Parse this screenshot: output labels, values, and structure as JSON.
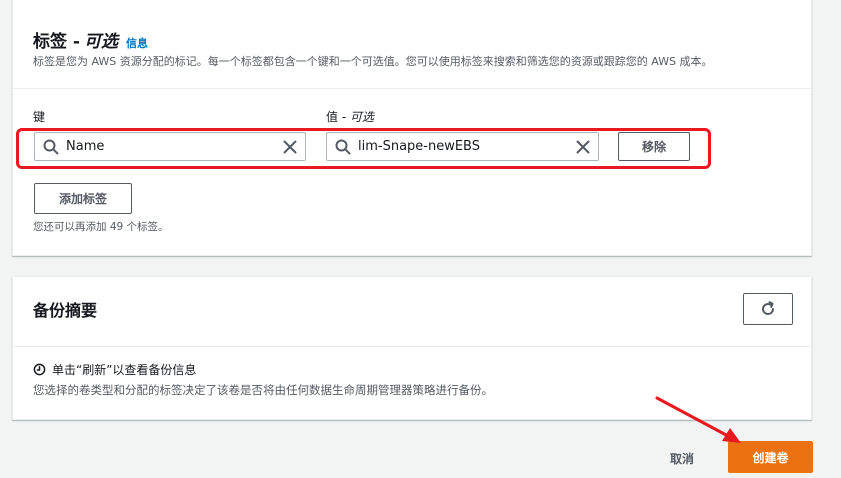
{
  "tags": {
    "title": "标签 -",
    "title_optional": "可选",
    "info_link": "信息",
    "description": "标签是您为 AWS 资源分配的标记。每一个标签都包含一个键和一个可选值。您可以使用标签来搜索和筛选您的资源或跟踪您的 AWS 成本。",
    "key_label": "键",
    "value_label": "值 -",
    "value_label_optional": "可选",
    "key_value": "Name",
    "value_value": "lim-Snape-newEBS",
    "remove_label": "移除",
    "add_tag_label": "添加标签",
    "remaining_hint": "您还可以再添加 49 个标签。"
  },
  "backup": {
    "title": "备份摘要",
    "refresh_hint": "单击“刷新”以查看备份信息",
    "description": "您选择的卷类型和分配的标签决定了该卷是否将由任何数据生命周期管理器策略进行备份。"
  },
  "footer": {
    "cancel_label": "取消",
    "create_label": "创建卷"
  },
  "colors": {
    "accent_orange": "#ec7211",
    "info_blue": "#0073bb",
    "highlight_red": "#e8191f"
  }
}
